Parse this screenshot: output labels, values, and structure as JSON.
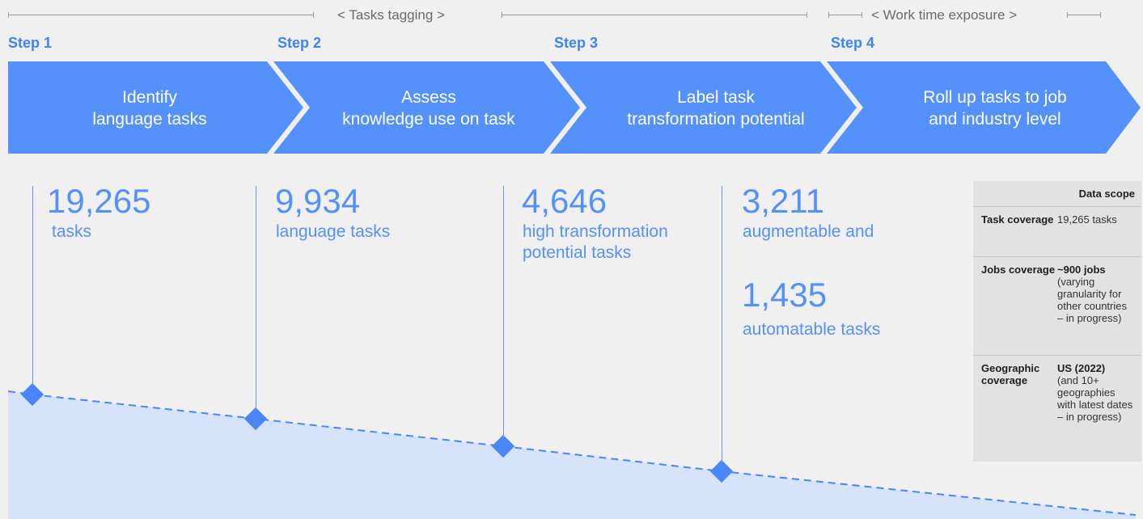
{
  "phases": {
    "tasks_tagging": "< Tasks tagging >",
    "work_time_exposure": "< Work time exposure >"
  },
  "steps": [
    {
      "label": "Step 1",
      "title_line1": "Identify",
      "title_line2": "language tasks"
    },
    {
      "label": "Step 2",
      "title_line1": "Assess",
      "title_line2": "knowledge use on task"
    },
    {
      "label": "Step 3",
      "title_line1": "Label task",
      "title_line2": "transformation potential"
    },
    {
      "label": "Step 4",
      "title_line1": "Roll up tasks to job",
      "title_line2": "and industry level"
    }
  ],
  "stats": [
    {
      "number": "19,265",
      "desc": "tasks"
    },
    {
      "number": "9,934",
      "desc": "language tasks"
    },
    {
      "number": "4,646",
      "desc_line1": "high transformation",
      "desc_line2": "potential tasks"
    },
    {
      "number": "3,211",
      "desc": "augmentable and"
    },
    {
      "number": "1,435",
      "desc": "automatable tasks"
    }
  ],
  "data_scope": {
    "header": "Data scope",
    "task_key": "Task coverage",
    "task_val": "19,265 tasks",
    "jobs_key": "Jobs coverage",
    "jobs_val_bold": "~900 jobs",
    "jobs_val": "(varying granularity for other countries – in progress)",
    "geo_key": "Geographic coverage",
    "geo_val_bold": "US (2022)",
    "geo_val": "(and 10+ geographies with latest dates – in progress)"
  },
  "colors": {
    "chevron": "#5591fa",
    "step_label": "#3d84fb",
    "fill_area": "#d5e3fb",
    "marker": "#4a86f7",
    "background": "#f0f0f0"
  }
}
